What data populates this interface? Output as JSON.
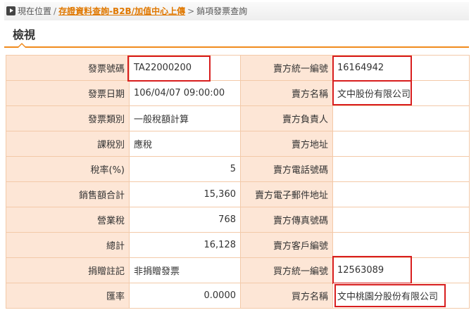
{
  "breadcrumb": {
    "prefix": "現在位置",
    "sep1": "/",
    "link": "存證資料查詢-B2B/加值中心上傳",
    "sep2": ">",
    "current": "銷項發票查詢"
  },
  "page_title": "檢視",
  "rows": [
    {
      "l1": "發票號碼",
      "v1": "TA22000200",
      "l2": "賣方統一編號",
      "v2": "16164942"
    },
    {
      "l1": "發票日期",
      "v1": "106/04/07 09:00:00",
      "l2": "賣方名稱",
      "v2": "文中股份有限公司"
    },
    {
      "l1": "發票類別",
      "v1": "一般稅額計算",
      "l2": "賣方負責人",
      "v2": ""
    },
    {
      "l1": "課稅別",
      "v1": "應稅",
      "l2": "賣方地址",
      "v2": ""
    },
    {
      "l1": "稅率(%)",
      "v1": "5",
      "l2": "賣方電話號碼",
      "v2": ""
    },
    {
      "l1": "銷售額合計",
      "v1": "15,360",
      "l2": "賣方電子郵件地址",
      "v2": ""
    },
    {
      "l1": "營業稅",
      "v1": "768",
      "l2": "賣方傳真號碼",
      "v2": ""
    },
    {
      "l1": "總計",
      "v1": "16,128",
      "l2": "賣方客戶編號",
      "v2": ""
    },
    {
      "l1": "捐贈註記",
      "v1": "非捐贈發票",
      "l2": "買方統一編號",
      "v2": "12563089"
    },
    {
      "l1": "匯率",
      "v1": "0.0000",
      "l2": "買方名稱",
      "v2": "文中桃園分股份有限公司"
    }
  ],
  "colors": {
    "accent": "#f08a1c",
    "label_bg": "#fde6d6",
    "highlight": "#d81e1e",
    "link": "#e07800"
  }
}
